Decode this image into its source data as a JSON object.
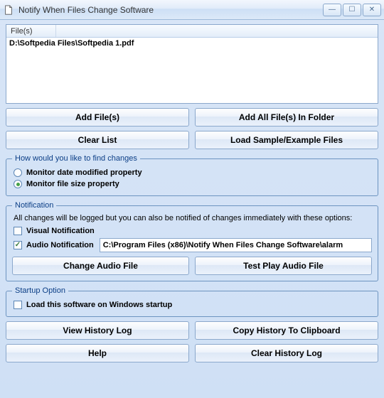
{
  "window": {
    "title": "Notify When Files Change Software"
  },
  "filelist": {
    "header": "File(s)",
    "items": [
      "D:\\Softpedia Files\\Softpedia 1.pdf"
    ]
  },
  "buttons": {
    "add_files": "Add File(s)",
    "add_all_folder": "Add All File(s) In Folder",
    "clear_list": "Clear List",
    "load_sample": "Load Sample/Example Files",
    "change_audio": "Change Audio File",
    "test_audio": "Test Play Audio File",
    "view_history": "View History Log",
    "copy_history": "Copy History To Clipboard",
    "help": "Help",
    "clear_history": "Clear History Log"
  },
  "groups": {
    "changes": {
      "legend": "How would you like to find changes",
      "opt_date": "Monitor date modified property",
      "opt_size": "Monitor file size property",
      "selected": "size"
    },
    "notification": {
      "legend": "Notification",
      "desc": "All changes will be logged but you can also be notified of changes immediately with these options:",
      "visual_label": "Visual Notification",
      "visual_checked": false,
      "audio_label": "Audio Notification",
      "audio_checked": true,
      "audio_path": "C:\\Program Files (x86)\\Notify When Files Change Software\\alarm"
    },
    "startup": {
      "legend": "Startup Option",
      "label": "Load this software on Windows startup",
      "checked": false
    }
  }
}
